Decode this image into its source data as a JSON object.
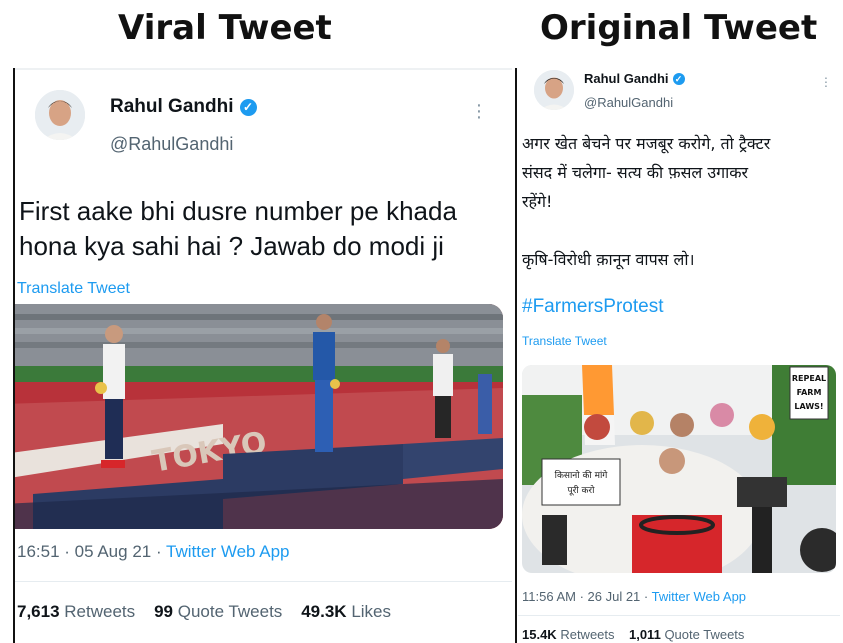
{
  "headings": {
    "left": "Viral Tweet",
    "right": "Original Tweet"
  },
  "viral": {
    "name": "Rahul Gandhi",
    "handle": "@RahulGandhi",
    "text_line1": "First aake bhi dusre number pe khada",
    "text_line2": "hona kya sahi hai ? Jawab do modi ji",
    "translate": "Translate Tweet",
    "time": "16:51 · 05 Aug 21",
    "source": "Twitter Web App",
    "stats": {
      "retweets_count": "7,613",
      "retweets_label": "Retweets",
      "quotes_count": "99",
      "quotes_label": "Quote Tweets",
      "likes_count": "49.3K",
      "likes_label": "Likes"
    }
  },
  "original": {
    "name": "Rahul Gandhi",
    "handle": "@RahulGandhi",
    "text_line1": "अगर खेत बेचने पर मजबूर करोगे, तो ट्रैक्टर",
    "text_line2": "संसद में चलेगा- सत्य की फ़सल उगाकर",
    "text_line3": "रहेंगे!",
    "text_line4": "कृषि-विरोधी क़ानून वापस लो।",
    "hashtag": "#FarmersProtest",
    "translate": "Translate Tweet",
    "time": "11:56 AM · 26 Jul 21",
    "source": "Twitter Web App",
    "stats": {
      "retweets_count": "15.4K",
      "retweets_label": "Retweets",
      "quotes_count": "1,011",
      "quotes_label": "Quote Tweets"
    },
    "photo_sign_1": "किसानो की मांगे पूरी करो",
    "photo_sign_2": "REPEAL FARM LAWS!"
  },
  "photo_text": {
    "stadium": "TOKYO"
  },
  "colors": {
    "link": "#1d9bf0",
    "muted": "#536471",
    "verified": "#1d9bf0"
  },
  "icons": [
    "verified-badge-icon",
    "more-options-icon"
  ]
}
